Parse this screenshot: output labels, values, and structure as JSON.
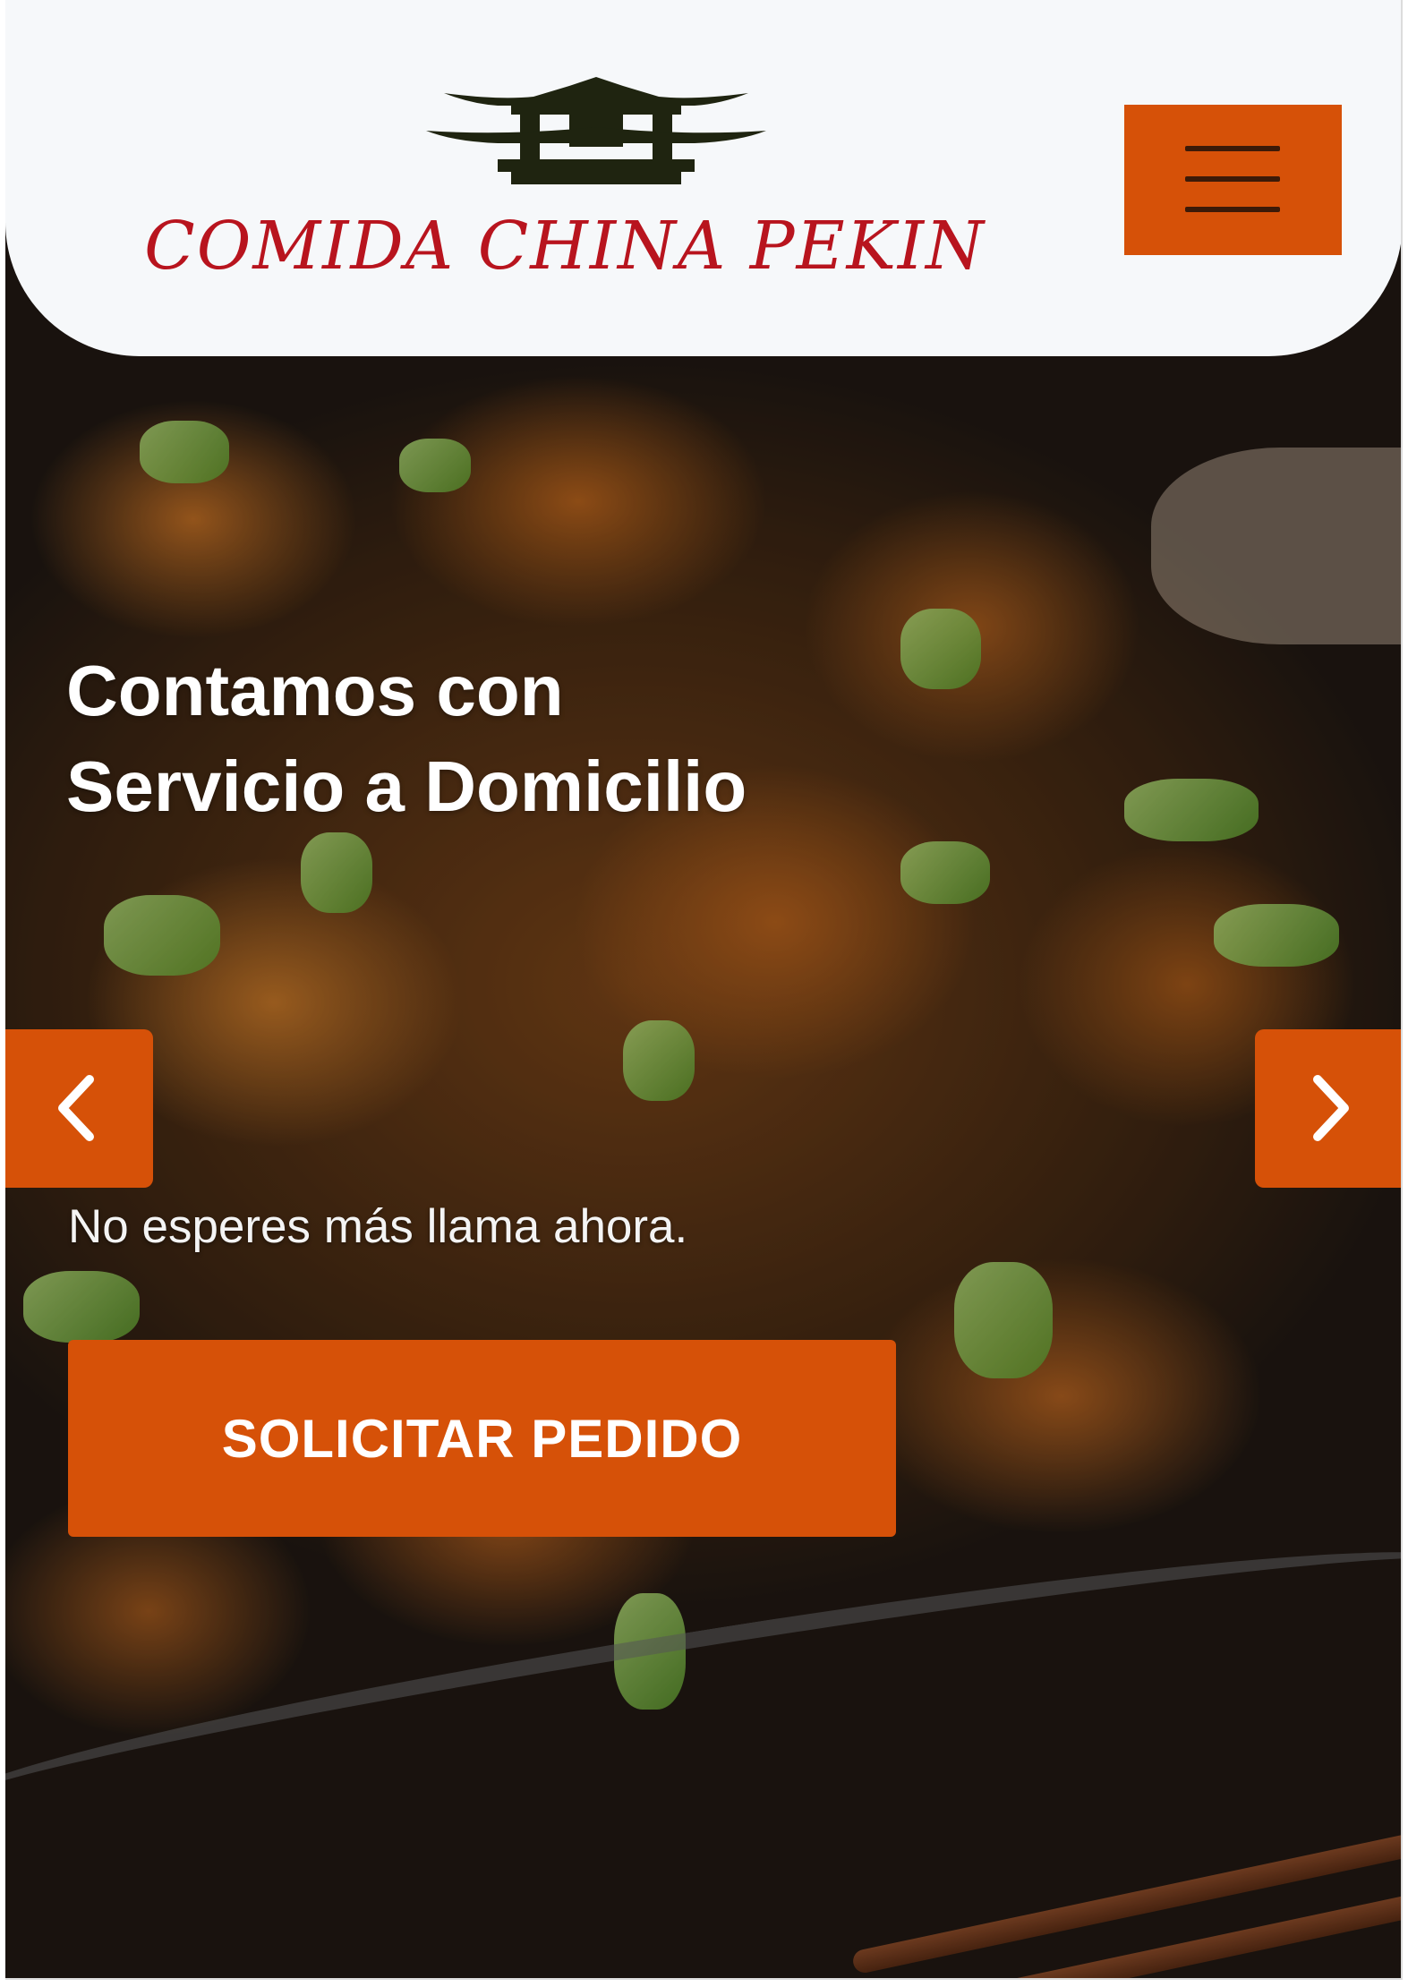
{
  "brand": {
    "name": "COMIDA CHINA PEKIN",
    "logo_icon": "pagoda-icon",
    "text_color": "#b8141e"
  },
  "header": {
    "menu_icon": "hamburger-menu-icon",
    "menu_button_color": "#d65108",
    "background": "#f6f8fa"
  },
  "hero": {
    "headline_line1": "Contamos con",
    "headline_line2": "Servicio a Domicilio",
    "subtext": "No esperes más llama ahora.",
    "cta_label": "SOLICITAR PEDIDO",
    "prev_icon": "chevron-left-icon",
    "next_icon": "chevron-right-icon",
    "accent_color": "#d65108"
  }
}
